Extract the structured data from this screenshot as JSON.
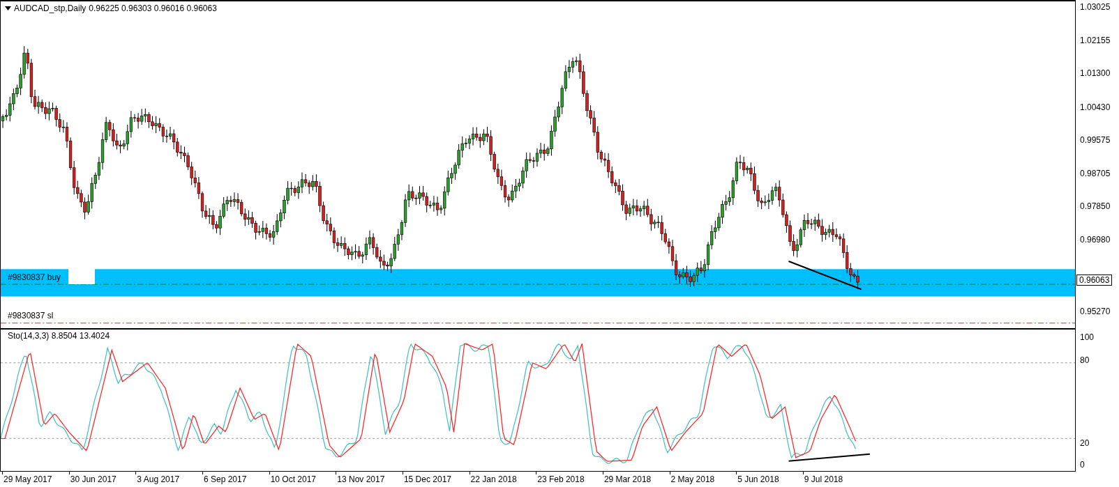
{
  "header": {
    "symbol": "AUDCAD_stp,Daily",
    "ohlc": "0.96225 0.96303 0.96016 0.96063"
  },
  "price_axis": {
    "ticks": [
      "1.03025",
      "1.02155",
      "1.01300",
      "1.00430",
      "0.99575",
      "0.98705",
      "0.97850",
      "0.96980",
      "0.95270"
    ],
    "current_price": "0.96063"
  },
  "orders": [
    {
      "kind": "buy",
      "label": "#9830837 buy"
    },
    {
      "kind": "sl",
      "label": "#9830837 sl"
    }
  ],
  "oscillator": {
    "title": "Sto(14,3,3) 8.8504 13.4024",
    "ticks": [
      "100",
      "80",
      "20",
      "0"
    ]
  },
  "date_axis": [
    "29 May 2017",
    "30 Jun 2017",
    "3 Aug 2017",
    "6 Sep 2017",
    "10 Oct 2017",
    "13 Nov 2017",
    "15 Dec 2017",
    "22 Jan 2018",
    "23 Feb 2018",
    "29 Mar 2018",
    "2 May 2018",
    "5 Jun 2018",
    "9 Jul 2018"
  ]
}
